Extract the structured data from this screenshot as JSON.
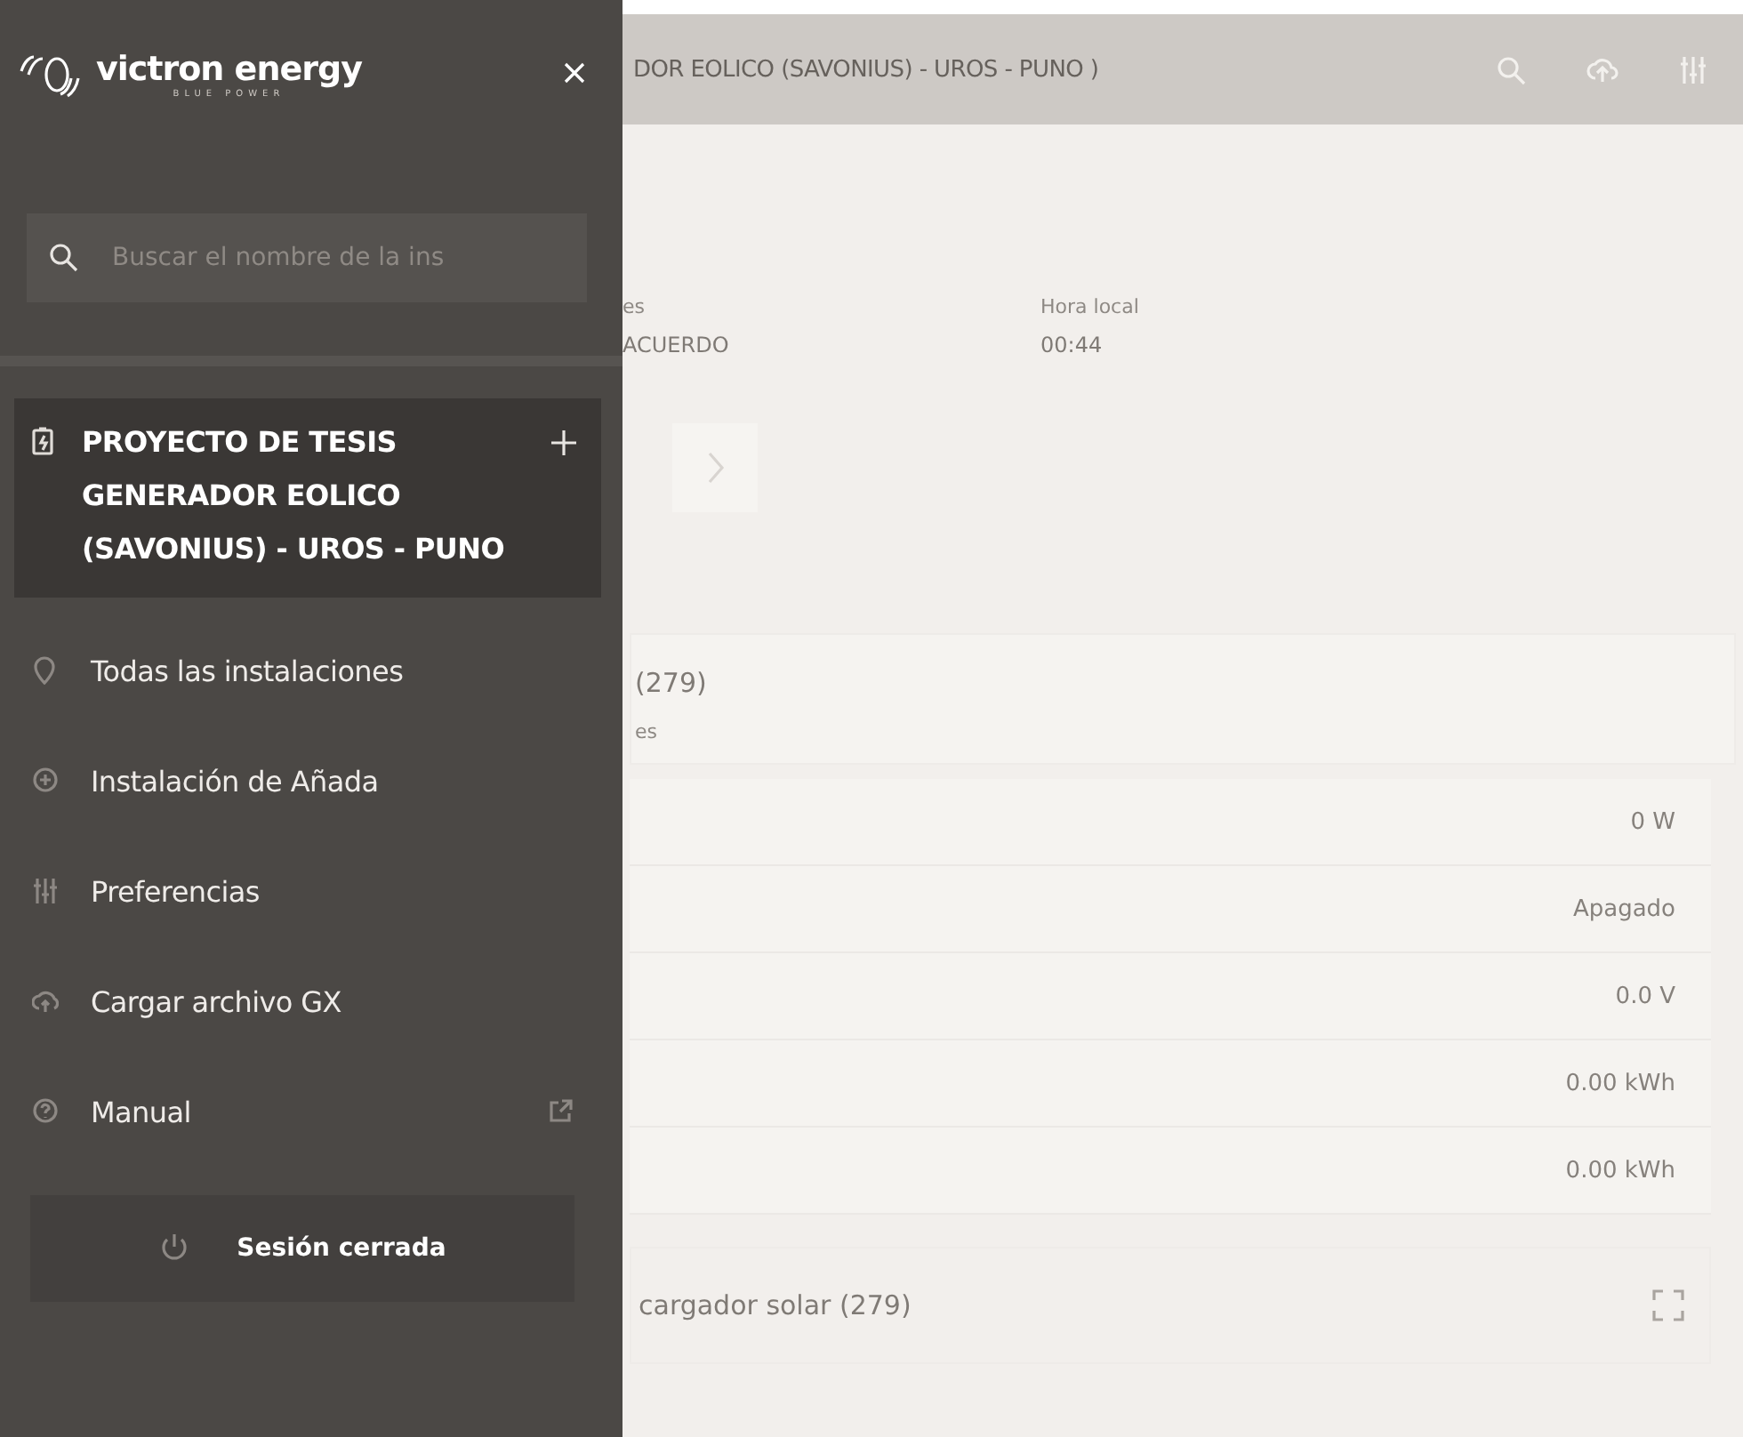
{
  "topbar": {
    "title": "DOR EOLICO (SAVONIUS) - UROS - PUNO )"
  },
  "summary": [
    {
      "label": "es",
      "value": "ACUERDO"
    },
    {
      "label": "Hora local",
      "value": "00:44"
    }
  ],
  "card": {
    "title": "(279)",
    "subtitle": "es"
  },
  "readings": [
    "0 W",
    "Apagado",
    "0.0 V",
    "0.00 kWh",
    "0.00 kWh"
  ],
  "bottom_card": {
    "title": "cargador solar (279)"
  },
  "sidebar": {
    "brand": "victron energy",
    "tagline": "BLUE POWER",
    "search": {
      "placeholder": "Buscar el nombre de la ins"
    },
    "installation": {
      "name": "PROYECTO DE TESIS GENERADOR EOLICO (SAVONIUS) - UROS - PUNO",
      "selected": true
    },
    "items": [
      {
        "kind": "pin",
        "label": "Todas las instalaciones",
        "external": false
      },
      {
        "kind": "add",
        "label": "Instalación de Añada",
        "external": false
      },
      {
        "kind": "sliders",
        "label": "Preferencias",
        "external": false
      },
      {
        "kind": "upload",
        "label": "Cargar archivo GX",
        "external": false
      },
      {
        "kind": "help",
        "label": "Manual",
        "external": true
      }
    ],
    "logout": "Sesión cerrada"
  }
}
